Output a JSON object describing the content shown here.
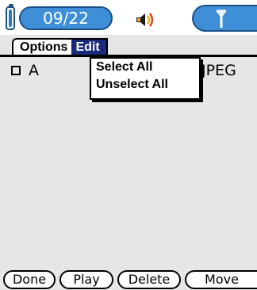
{
  "status": {
    "date": "09/22",
    "battery_icon": "battery-icon",
    "speaker_icon": "speaker-icon",
    "antenna_icon": "antenna-icon"
  },
  "menu": {
    "items": [
      "Options",
      "Edit"
    ],
    "active": "Edit"
  },
  "dropdown": {
    "items": [
      "Select All",
      "Unselect All"
    ]
  },
  "list": {
    "rows": [
      {
        "name": "A",
        "type": "JPEG",
        "checked": false
      }
    ]
  },
  "buttons": {
    "done": "Done",
    "play": "Play",
    "delete": "Delete",
    "move": "Move"
  },
  "colors": {
    "accent": "#3f8fd8",
    "menu_highlight": "#1a2a7a",
    "background": "#e6e6e6"
  }
}
